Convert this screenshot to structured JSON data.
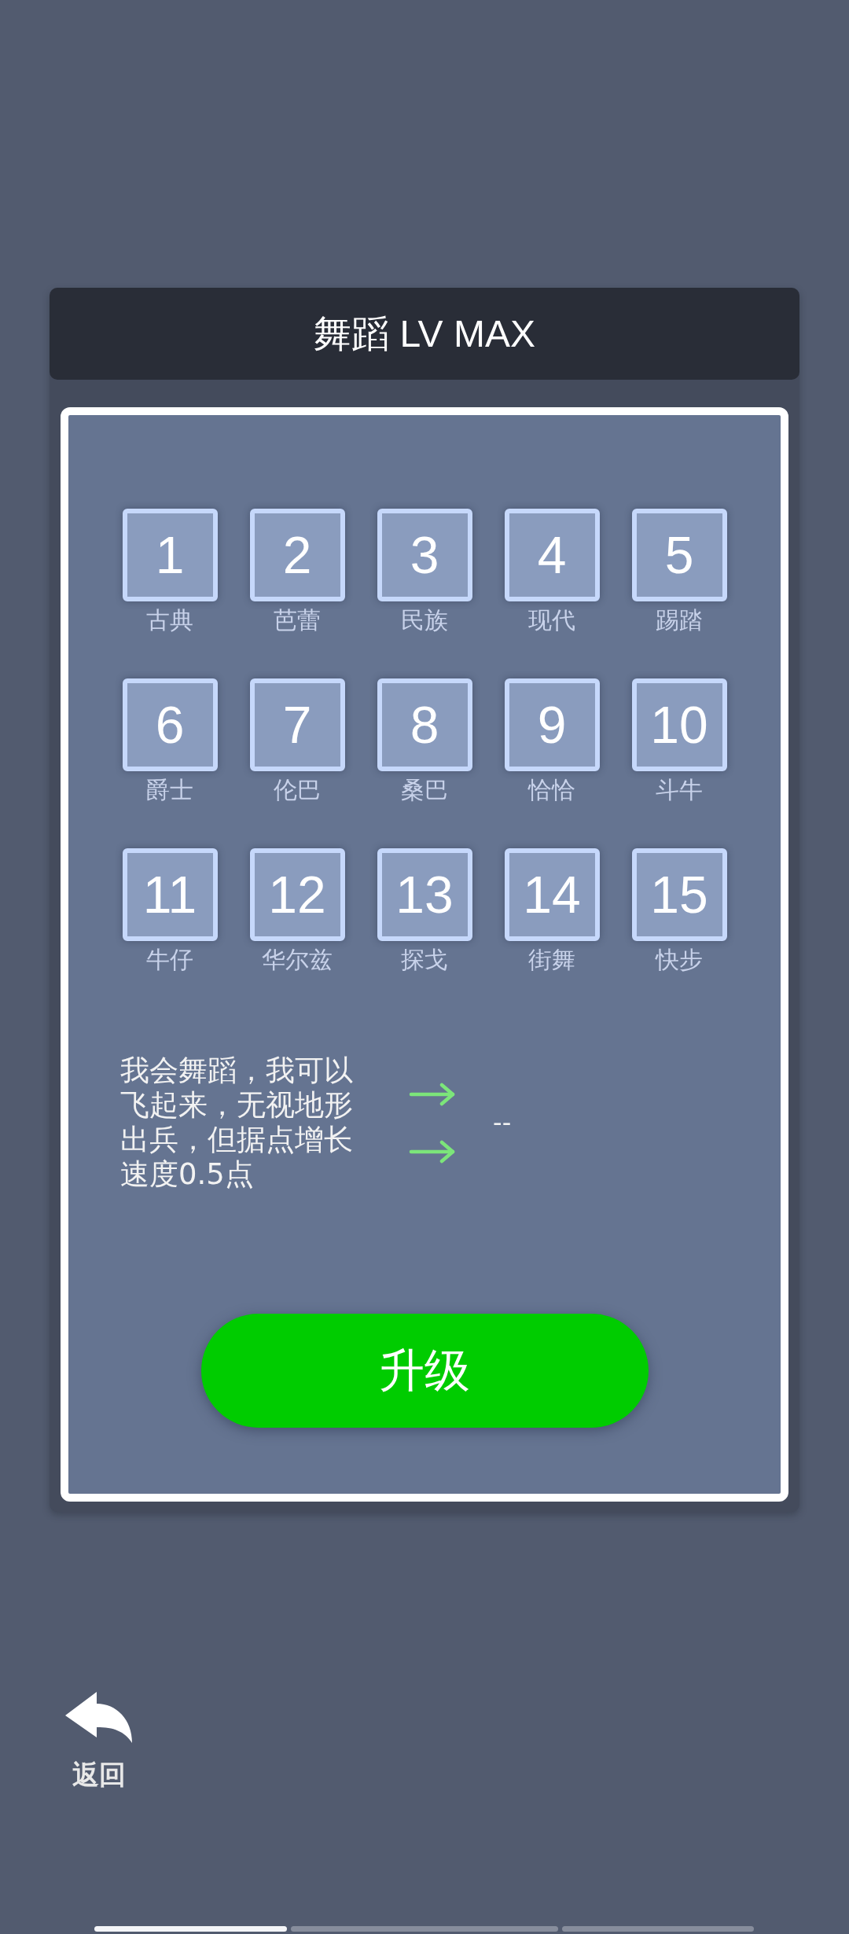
{
  "title": "舞蹈 LV MAX",
  "levels": [
    {
      "number": "1",
      "name": "古典"
    },
    {
      "number": "2",
      "name": "芭蕾"
    },
    {
      "number": "3",
      "name": "民族"
    },
    {
      "number": "4",
      "name": "现代"
    },
    {
      "number": "5",
      "name": "踢踏"
    },
    {
      "number": "6",
      "name": "爵士"
    },
    {
      "number": "7",
      "name": "伦巴"
    },
    {
      "number": "8",
      "name": "桑巴"
    },
    {
      "number": "9",
      "name": "恰恰"
    },
    {
      "number": "10",
      "name": "斗牛"
    },
    {
      "number": "11",
      "name": "牛仔"
    },
    {
      "number": "12",
      "name": "华尔兹"
    },
    {
      "number": "13",
      "name": "探戈"
    },
    {
      "number": "14",
      "name": "街舞"
    },
    {
      "number": "15",
      "name": "快步"
    }
  ],
  "effect": {
    "description": "我会舞蹈，我可以飞起来，无视地形出兵，但据点增长速度0.5点",
    "next_value": "--"
  },
  "upgrade_button": "升级",
  "back_button": "返回",
  "page_indicator": [
    {
      "selected": true
    },
    {
      "selected": false
    },
    {
      "selected": false
    }
  ]
}
